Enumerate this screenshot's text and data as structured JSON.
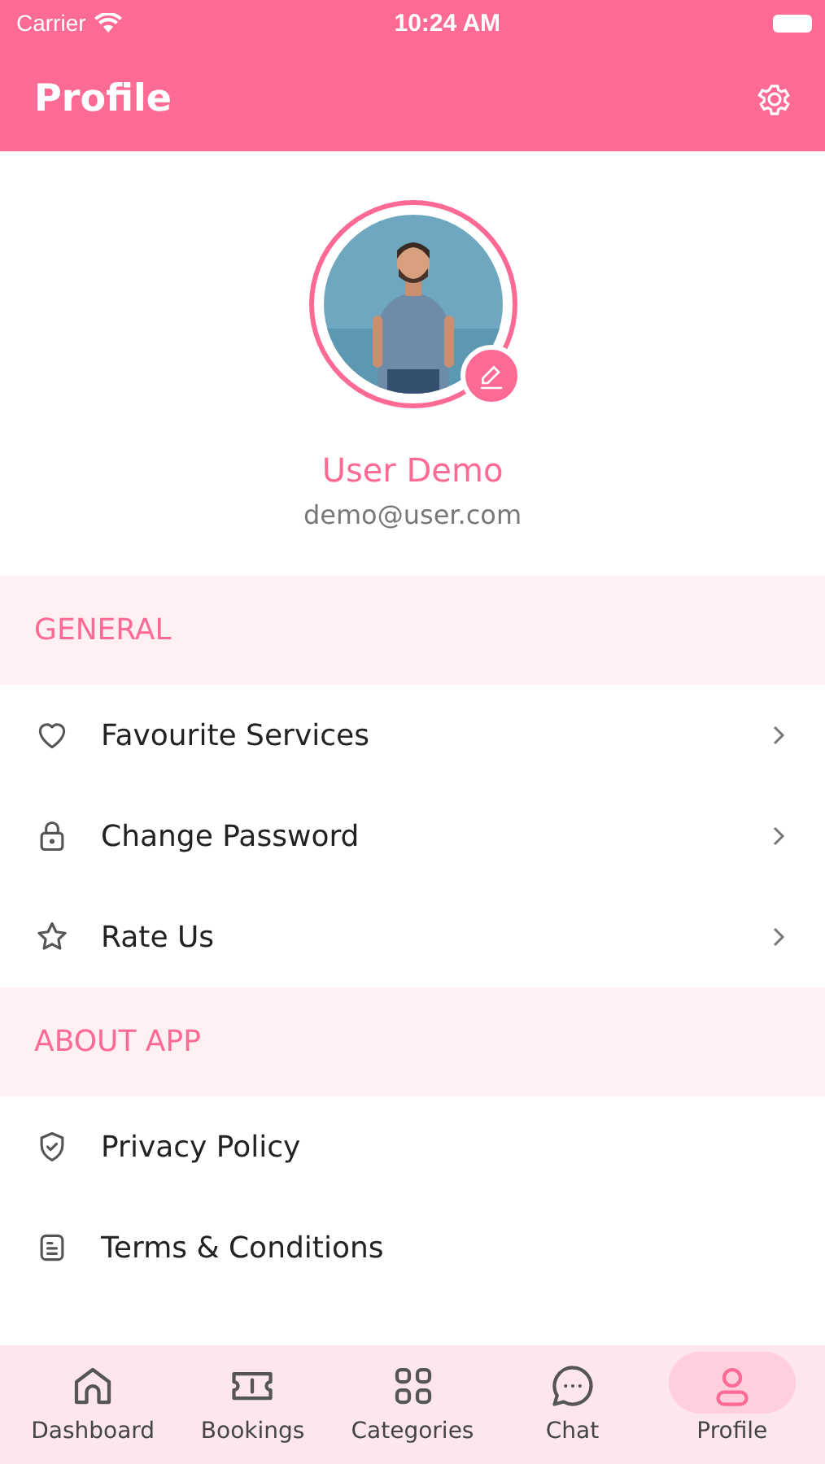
{
  "status_bar": {
    "carrier": "Carrier",
    "time": "10:24 AM"
  },
  "header": {
    "title": "Profile"
  },
  "profile": {
    "name": "User Demo",
    "email": "demo@user.com"
  },
  "sections": [
    {
      "title": "GENERAL",
      "items": [
        {
          "label": "Favourite Services",
          "kind": "heart",
          "chevron": true
        },
        {
          "label": "Change Password",
          "kind": "lock",
          "chevron": true
        },
        {
          "label": "Rate Us",
          "kind": "star",
          "chevron": true
        }
      ]
    },
    {
      "title": "ABOUT APP",
      "items": [
        {
          "label": "Privacy Policy",
          "kind": "shield",
          "chevron": false
        },
        {
          "label": "Terms & Conditions",
          "kind": "document",
          "chevron": false
        }
      ]
    }
  ],
  "tab_bar": [
    {
      "label": "Dashboard",
      "kind": "home",
      "selected": false
    },
    {
      "label": "Bookings",
      "kind": "ticket",
      "selected": false
    },
    {
      "label": "Categories",
      "kind": "grid",
      "selected": false
    },
    {
      "label": "Chat",
      "kind": "chat",
      "selected": false
    },
    {
      "label": "Profile",
      "kind": "person",
      "selected": true
    }
  ]
}
